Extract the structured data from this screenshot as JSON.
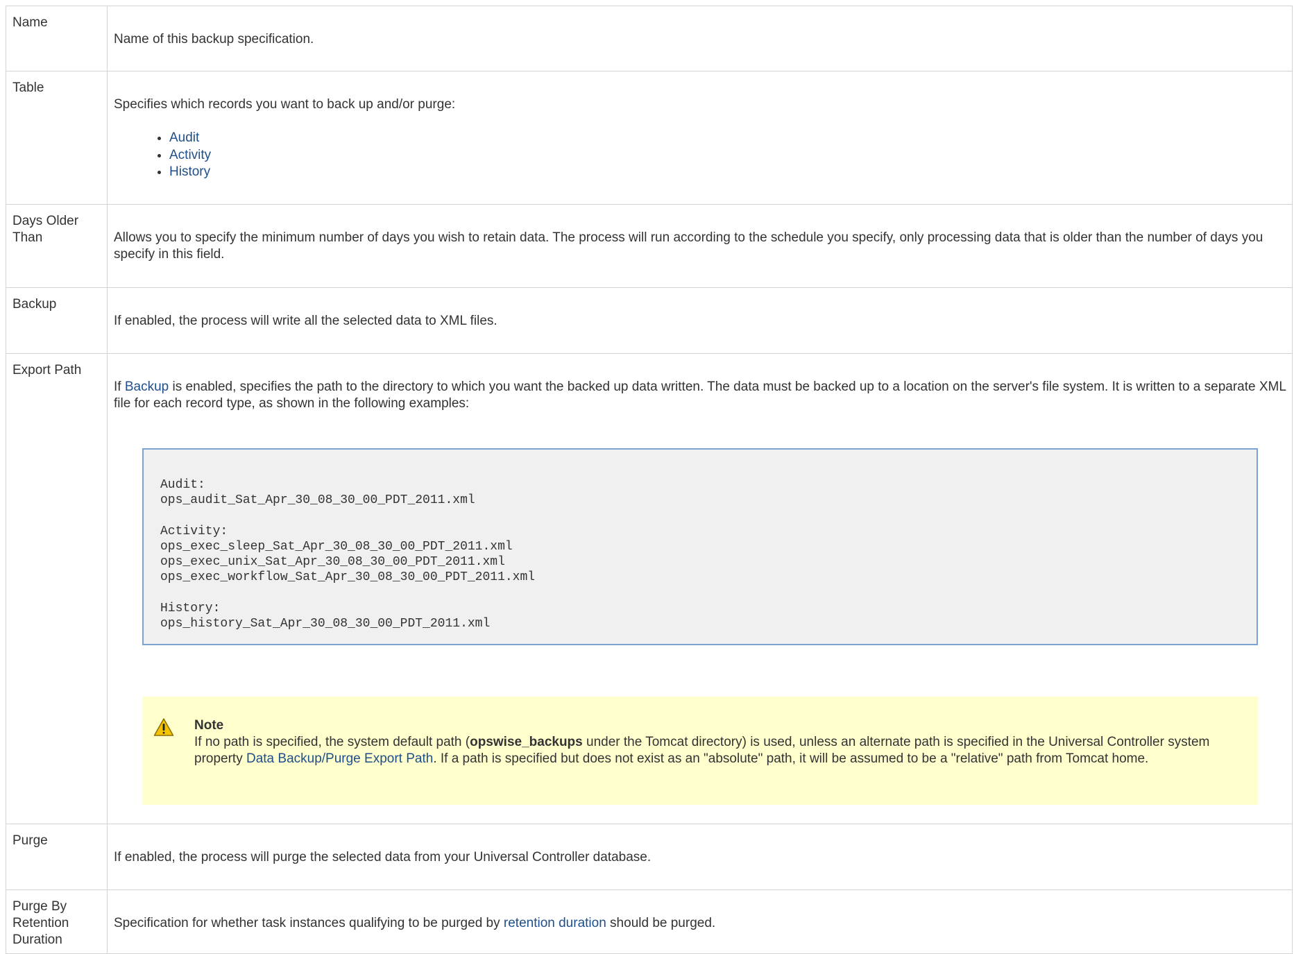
{
  "rows": [
    {
      "label": "Name",
      "desc": "Name of this backup specification."
    },
    {
      "label": "Table",
      "desc": "Specifies which records you want to back up and/or purge:",
      "items": [
        "Audit",
        "Activity",
        "History"
      ]
    },
    {
      "label_line1": "Days Older",
      "label_line2": "Than",
      "desc": "Allows you to specify the minimum number of days you wish to retain data. The process will run according to the schedule you specify, only processing data that is older than the number of days you specify in this field."
    },
    {
      "label": "Backup",
      "desc": "If enabled, the process will write all the selected data to XML files."
    },
    {
      "label": "Export Path",
      "desc_pre": "If ",
      "desc_link": "Backup",
      "desc_post": " is enabled, specifies the path to the directory to which you want the backed up data written. The data must be backed up to a location on the server's file system. It is written to a separate XML file for each record type, as shown in the following examples:",
      "code": "Audit:\nops_audit_Sat_Apr_30_08_30_00_PDT_2011.xml\n\nActivity:\nops_exec_sleep_Sat_Apr_30_08_30_00_PDT_2011.xml\nops_exec_unix_Sat_Apr_30_08_30_00_PDT_2011.xml\nops_exec_workflow_Sat_Apr_30_08_30_00_PDT_2011.xml\n\nHistory:\nops_history_Sat_Apr_30_08_30_00_PDT_2011.xml",
      "note": {
        "title": "Note",
        "text_1": "If no path is specified, the system default path (",
        "bold": "opswise_backups",
        "text_2": " under the Tomcat directory) is used, unless an alternate path is specified in the Universal Controller system property ",
        "link": "Data Backup/Purge Export Path",
        "text_3": ". If a path is specified but does not exist as an \"absolute\" path, it will be assumed to be a \"relative\" path from Tomcat home."
      }
    },
    {
      "label": "Purge",
      "desc": "If enabled, the process will purge the selected data from your Universal Controller database."
    },
    {
      "label_line1": "Purge By",
      "label_line2": "Retention",
      "label_line3": "Duration",
      "desc_pre": "Specification for whether task instances qualifying to be purged by ",
      "desc_link": "retention duration",
      "desc_post": " should be purged."
    }
  ],
  "colors": {
    "link": "#1e4f8c",
    "border": "#d3d3d3",
    "code_bg": "#f0f0f0",
    "code_border": "#7aa3d2",
    "note_bg": "#ffffce",
    "warning_icon": "#f5c400"
  },
  "icons": {
    "note": "warning-icon"
  }
}
